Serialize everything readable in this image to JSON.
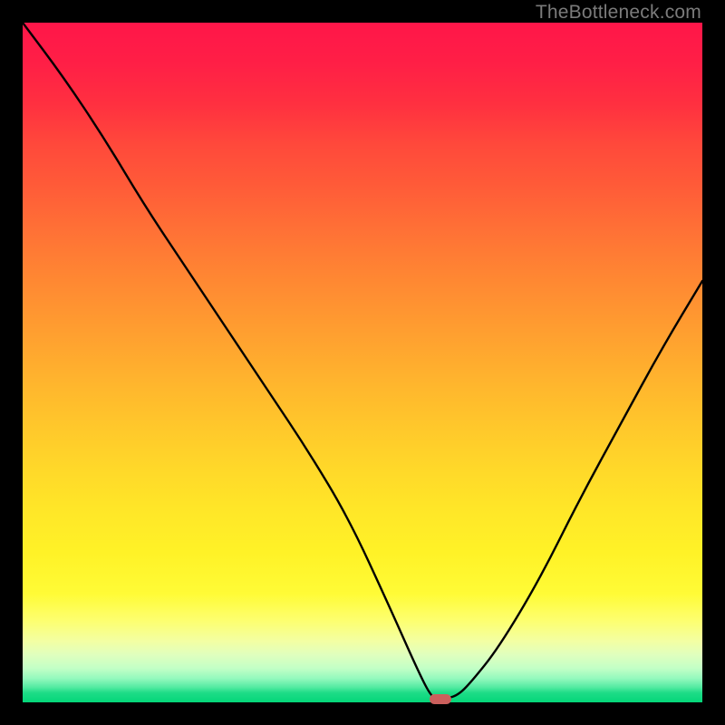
{
  "watermark": "TheBottleneck.com",
  "colors": {
    "frame": "#000000",
    "curve": "#000000",
    "marker": "#cb5f5c"
  },
  "chart_data": {
    "type": "line",
    "title": "",
    "xlabel": "",
    "ylabel": "",
    "xlim": [
      0,
      100
    ],
    "ylim": [
      0,
      100
    ],
    "x": [
      0,
      6,
      12,
      18,
      24,
      30,
      36,
      42,
      48,
      54,
      58,
      60,
      61,
      62,
      64,
      66,
      70,
      76,
      82,
      88,
      94,
      100
    ],
    "values": [
      100,
      92,
      83,
      73,
      64,
      55,
      46,
      37,
      27,
      14,
      5,
      1,
      0.5,
      0.5,
      1,
      3,
      8,
      18,
      30,
      41,
      52,
      62
    ],
    "marker": {
      "x": 61.5,
      "y": 0.5
    },
    "background_gradient": {
      "stops": [
        {
          "pct": 0,
          "color": "#ff1649"
        },
        {
          "pct": 50,
          "color": "#ffa62f"
        },
        {
          "pct": 85,
          "color": "#fffb36"
        },
        {
          "pct": 100,
          "color": "#04d679"
        }
      ]
    }
  }
}
